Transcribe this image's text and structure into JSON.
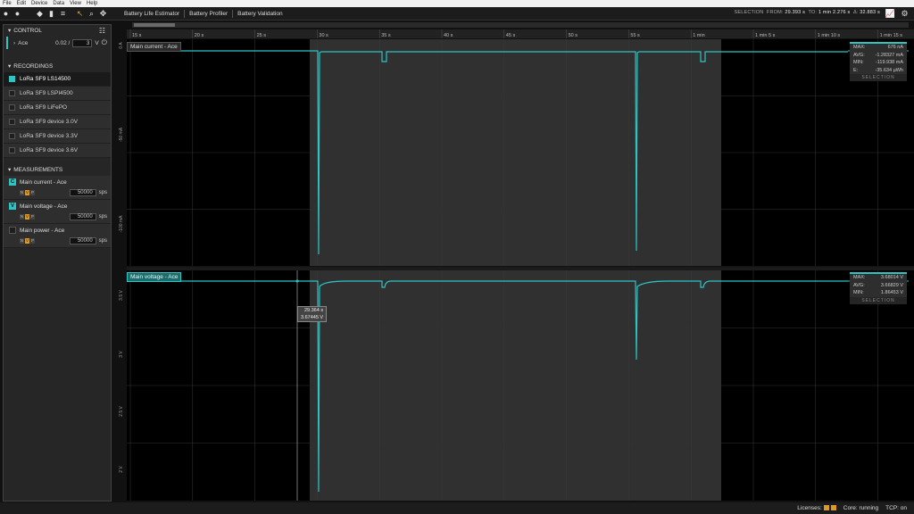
{
  "menu": [
    "File",
    "Edit",
    "Device",
    "Data",
    "View",
    "Help"
  ],
  "toolbar": {
    "tabs": [
      "Battery Life Estimator",
      "Battery Profiler",
      "Battery Validation"
    ],
    "selection_label": "SELECTION",
    "from_label": "FROM:",
    "from_value": "29.393 s",
    "to_label": "TO:",
    "to_value": "1 min 2.276 s",
    "delta_label": "Δ:",
    "delta_value": "32.883 s"
  },
  "sidebar": {
    "control": {
      "title": "CONTROL",
      "device": "Ace",
      "value": "0.02 /",
      "voltage": "3",
      "unit": "V"
    },
    "recordings": {
      "title": "RECORDINGS",
      "items": [
        {
          "label": "LoRa SF9 LS14500",
          "checked": true,
          "active": true
        },
        {
          "label": "LoRa SF9 LSPI4500",
          "checked": false,
          "active": false
        },
        {
          "label": "LoRa SF9 LiFePO",
          "checked": false,
          "active": false
        },
        {
          "label": "LoRa SF9 device 3.0V",
          "checked": false,
          "active": false
        },
        {
          "label": "LoRa SF9 device 3.3V",
          "checked": false,
          "active": false
        },
        {
          "label": "LoRa SF9 device 3.6V",
          "checked": false,
          "active": false
        }
      ]
    },
    "measurements": {
      "title": "MEASUREMENTS",
      "items": [
        {
          "label": "Main current - Ace",
          "letter": "C",
          "on": true,
          "sps": "50000",
          "sps_unit": "sps"
        },
        {
          "label": "Main voltage - Ace",
          "letter": "V",
          "on": true,
          "sps": "50000",
          "sps_unit": "sps"
        },
        {
          "label": "Main power - Ace",
          "letter": "",
          "on": false,
          "sps": "50000",
          "sps_unit": "sps"
        }
      ],
      "flags": [
        "N",
        "V",
        "P"
      ]
    }
  },
  "timeline": {
    "ticks": [
      "15 s",
      "20 s",
      "25 s",
      "30 s",
      "35 s",
      "40 s",
      "45 s",
      "50 s",
      "55 s",
      "1 min",
      "1 min 5 s",
      "1 min 10 s",
      "1 min 15 s"
    ]
  },
  "current_plot": {
    "label": "Main current - Ace",
    "y_ticks": [
      "0 A",
      "-50 mA",
      "-100 mA"
    ],
    "stats": {
      "max_label": "MAX:",
      "max": "676 nA",
      "avg_label": "AVG:",
      "avg": "-1.28327 mA",
      "min_label": "MIN:",
      "min": "-119.938 mA",
      "e_label": "E:",
      "e": "-35.634 µWh",
      "footer": "SELECTION"
    }
  },
  "voltage_plot": {
    "label": "Main voltage - Ace",
    "y_ticks": [
      "3.5 V",
      "3 V",
      "2.5 V",
      "2 V"
    ],
    "cursor_time": "29.364 s",
    "cursor_value": "3.67445 V",
    "stats": {
      "max_label": "MAX:",
      "max": "3.68014 V",
      "avg_label": "AVG:",
      "avg": "3.66829 V",
      "min_label": "MIN:",
      "min": "1.86453 V",
      "footer": "SELECTION"
    }
  },
  "status": {
    "licenses": "Licenses:",
    "core": "Core: running",
    "tcp": "TCP: on"
  },
  "colors": {
    "accent": "#2ec4c4",
    "warning": "#d89a2a"
  }
}
